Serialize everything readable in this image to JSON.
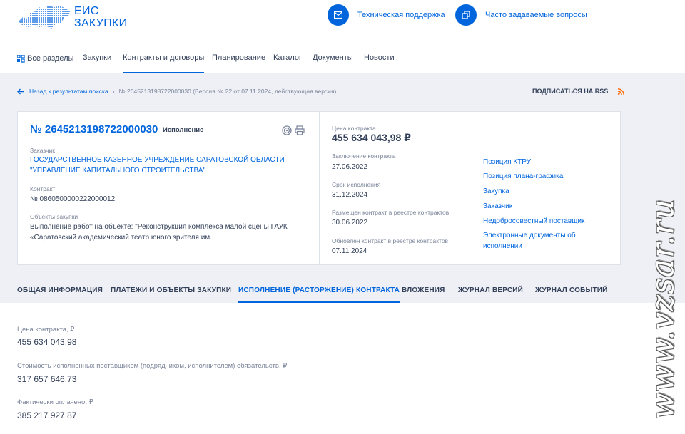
{
  "header": {
    "logo_line1": "ЕИС",
    "logo_line2": "ЗАКУПКИ",
    "support": "Техническая поддержка",
    "faq": "Часто задаваемые вопросы"
  },
  "nav": {
    "items": [
      "Все разделы",
      "Закупки",
      "Контракты и договоры",
      "Планирование",
      "Каталог",
      "Документы",
      "Новости"
    ],
    "active": "Контракты и договоры"
  },
  "breadcrumb": {
    "back": "Назад к результатам поиска",
    "current": "№ 2645213198722000030 (Версия № 22 от 07.11.2024, действующая версия)"
  },
  "subscribe": "ПОДПИСАТЬСЯ НА RSS",
  "contract": {
    "number": "№ 2645213198722000030",
    "status": "Исполнение",
    "customer_label": "Заказчик",
    "customer_line1": "ГОСУДАРСТВЕННОЕ КАЗЕННОЕ УЧРЕЖДЕНИЕ САРАТОВСКОЙ ОБЛАСТИ",
    "customer_line2": "\"УПРАВЛЕНИЕ КАПИТАЛЬНОГО СТРОИТЕЛЬСТВА\"",
    "contract_label": "Контракт",
    "contract_value": "№ 0860500000222000012",
    "objects_label": "Объекты закупки",
    "objects_line1": "Выполнение работ на объекте: \"Реконструкция комплекса малой сцены ГАУК",
    "objects_line2": "«Саратовский академический театр юного зрителя им..."
  },
  "details": {
    "price_label": "Цена контракта",
    "price_value": "455 634 043,98 ₽",
    "conclusion_label": "Заключение контракта",
    "conclusion_value": "27.06.2022",
    "term_label": "Срок исполнения",
    "term_value": "31.12.2024",
    "placed_label": "Размещен контракт в реестре контрактов",
    "placed_value": "30.06.2022",
    "updated_label": "Обновлен контракт в реестре контрактов",
    "updated_value": "07.11.2024"
  },
  "links": {
    "ktru": "Позиция КТРУ",
    "plan": "Позиция плана-графика",
    "purchase": "Закупка",
    "customer": "Заказчик",
    "unfair": "Недобросовестный поставщик",
    "edocs_line1": "Электронные документы об",
    "edocs_line2": "исполнении"
  },
  "tabs": {
    "items": [
      "ОБЩАЯ ИНФОРМАЦИЯ",
      "ПЛАТЕЖИ И ОБЪЕКТЫ ЗАКУПКИ",
      "ИСПОЛНЕНИЕ (РАСТОРЖЕНИЕ) КОНТРАКТА",
      "ВЛОЖЕНИЯ",
      "ЖУРНАЛ ВЕРСИЙ",
      "ЖУРНАЛ СОБЫТИЙ"
    ],
    "active": "ИСПОЛНЕНИЕ (РАСТОРЖЕНИЕ) КОНТРАКТА"
  },
  "execution": {
    "price_label": "Цена контракта, ₽",
    "price_value": "455 634 043,98",
    "executed_label": "Стоимость исполненных поставщиком (подрядчиком, исполнителем) обязательств, ₽",
    "executed_value": "317 657 646,73",
    "paid_label": "Фактически оплачено, ₽",
    "paid_value": "385 217 927,87"
  },
  "watermark": "www.vzsar.ru",
  "colors": {
    "accent": "#0065dd",
    "text": "#334059",
    "muted": "#7a8499",
    "rss": "#ff6600",
    "background_grey": "#eef0f5"
  },
  "icons": [
    "russia-map-logo-icon",
    "mail-icon",
    "copy-icon",
    "grid-icon",
    "arrow-left-icon",
    "chevron-right-icon",
    "rss-icon",
    "target-icon",
    "printer-icon"
  ]
}
